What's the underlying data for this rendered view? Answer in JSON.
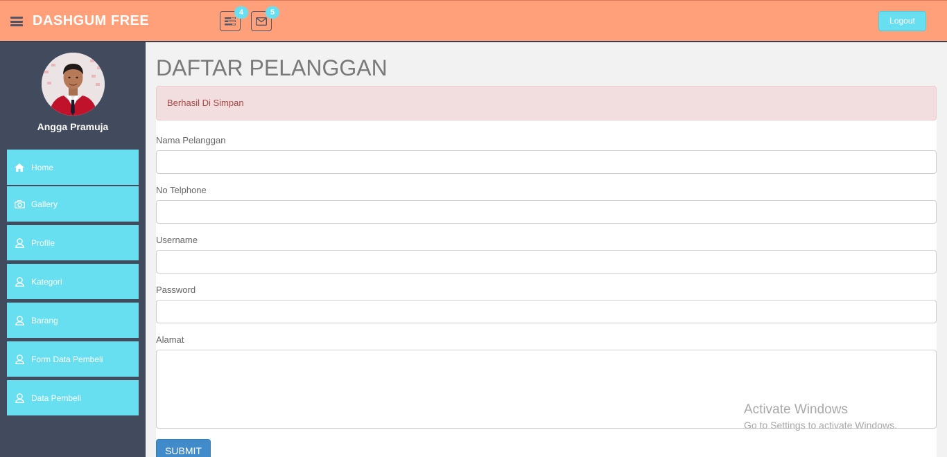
{
  "header": {
    "brand": "DASHGUM FREE",
    "tasks_badge": "4",
    "mail_badge": "5",
    "logout_label": "Logout"
  },
  "sidebar": {
    "user_name": "Angga Pramuja",
    "items": [
      {
        "label": "Home",
        "icon": "home-icon"
      },
      {
        "label": "Gallery",
        "icon": "camera-icon"
      },
      {
        "label": "Profile",
        "icon": "user-icon"
      },
      {
        "label": "Kategori",
        "icon": "user-icon"
      },
      {
        "label": "Barang",
        "icon": "user-icon"
      },
      {
        "label": "Form Data Pembeli",
        "icon": "user-icon"
      },
      {
        "label": "Data Pembeli",
        "icon": "user-icon"
      }
    ]
  },
  "main": {
    "page_title": "DAFTAR PELANGGAN",
    "alert": "Berhasil Di Simpan",
    "fields": {
      "nama_label": "Nama Pelanggan",
      "nama_value": "",
      "telp_label": "No Telphone",
      "telp_value": "",
      "username_label": "Username",
      "username_value": "",
      "password_label": "Password",
      "password_value": "",
      "alamat_label": "Alamat",
      "alamat_value": ""
    },
    "submit_label": "SUBMIT"
  },
  "watermark": {
    "line1": "Activate Windows",
    "line2": "Go to Settings to activate Windows."
  },
  "colors": {
    "topbar": "#ffa07a",
    "sidebar": "#424a5d",
    "accent": "#68dff0",
    "alert_bg": "#f2dede",
    "alert_text": "#a94442",
    "submit": "#428bca"
  }
}
